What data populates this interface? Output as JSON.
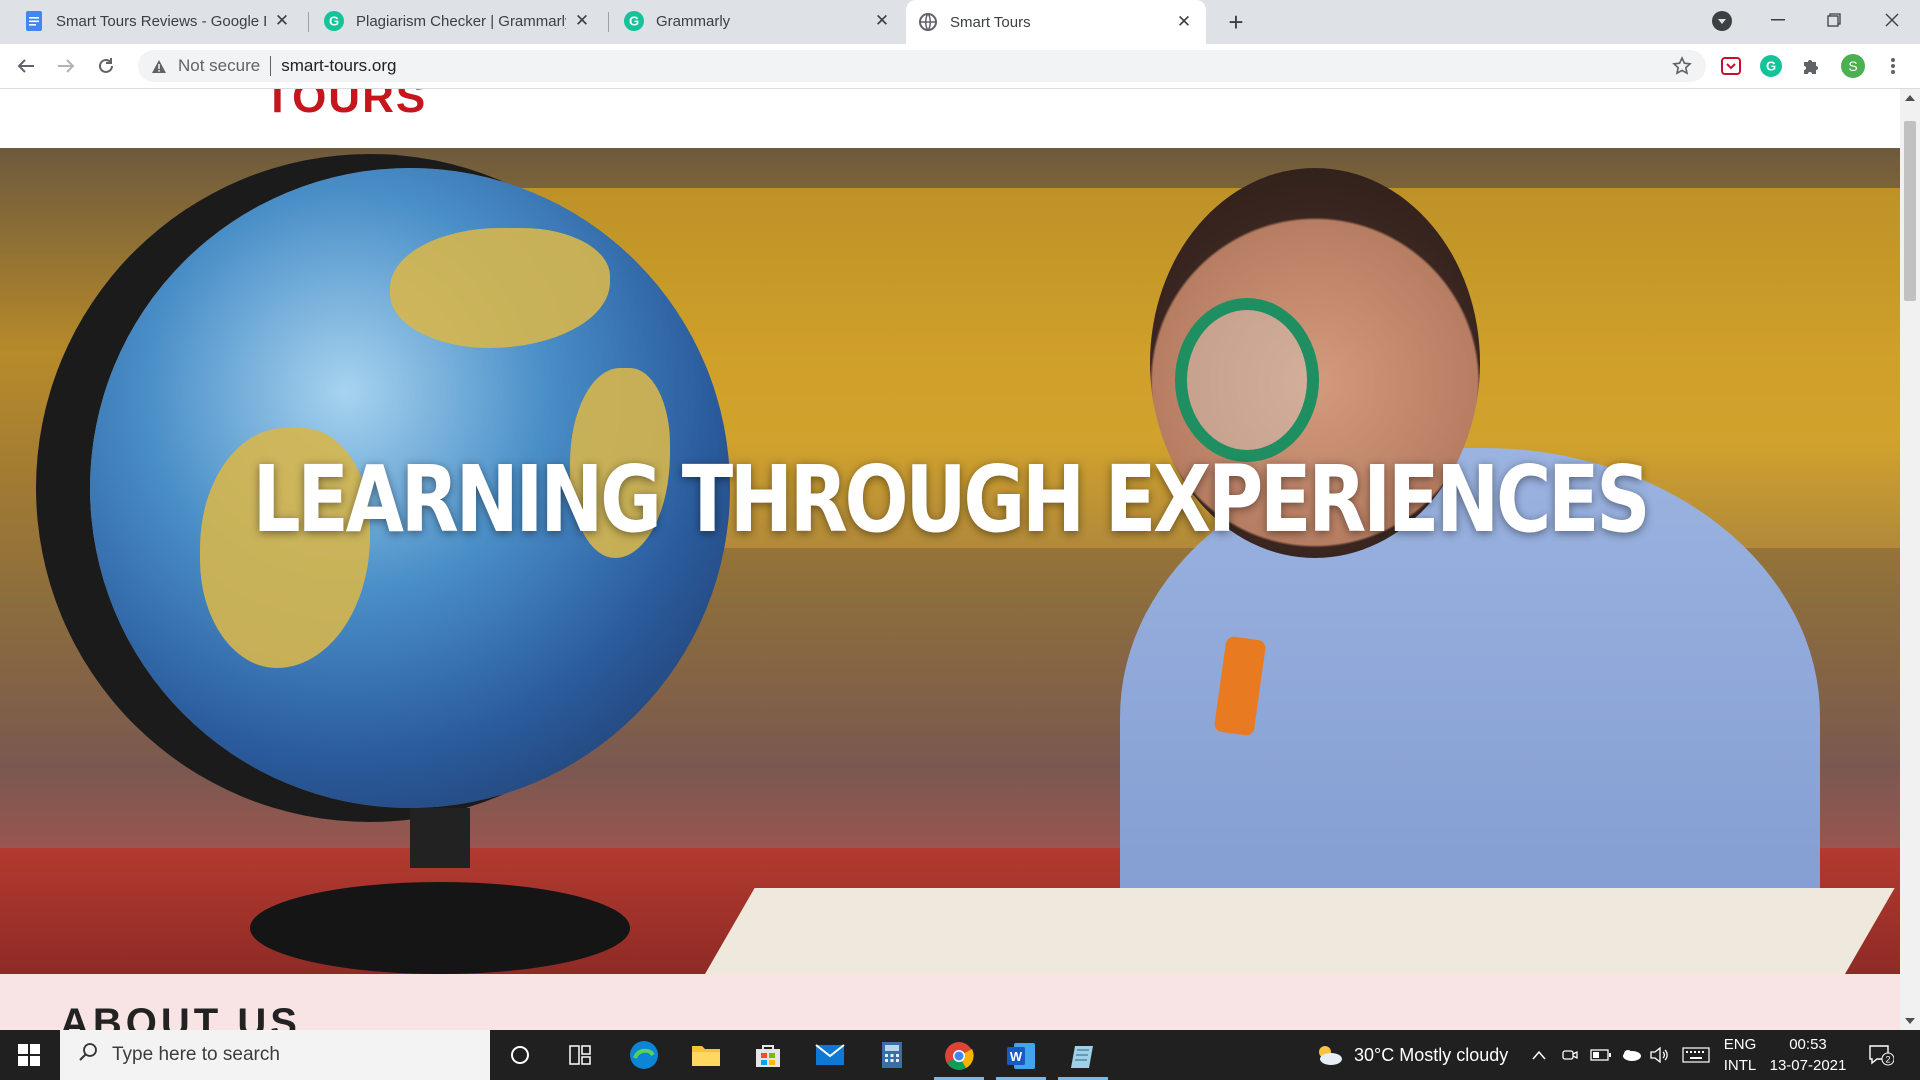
{
  "browser": {
    "tabs": [
      {
        "title": "Smart Tours Reviews - Google Do",
        "icon": "google-docs-icon",
        "active": false
      },
      {
        "title": "Plagiarism Checker | Grammarly",
        "icon": "grammarly-icon",
        "active": false
      },
      {
        "title": "Grammarly",
        "icon": "grammarly-icon",
        "active": false
      },
      {
        "title": "Smart Tours",
        "icon": "globe-icon",
        "active": true
      }
    ],
    "address": {
      "security_label": "Not secure",
      "url": "smart-tours.org"
    },
    "profile_initial": "S"
  },
  "page": {
    "logo_text": "TOURS",
    "hero_title": "LEARNING THROUGH EXPERIENCES",
    "section_heading": "ABOUT US"
  },
  "taskbar": {
    "search_placeholder": "Type here to search",
    "weather": "30°C  Mostly cloudy",
    "language": [
      "ENG",
      "INTL"
    ],
    "time": "00:53",
    "date": "13-07-2021",
    "notifications": "2"
  },
  "colors": {
    "brand_red": "#c4161c",
    "chrome_frame": "#dee1e6",
    "taskbar": "#202020"
  }
}
